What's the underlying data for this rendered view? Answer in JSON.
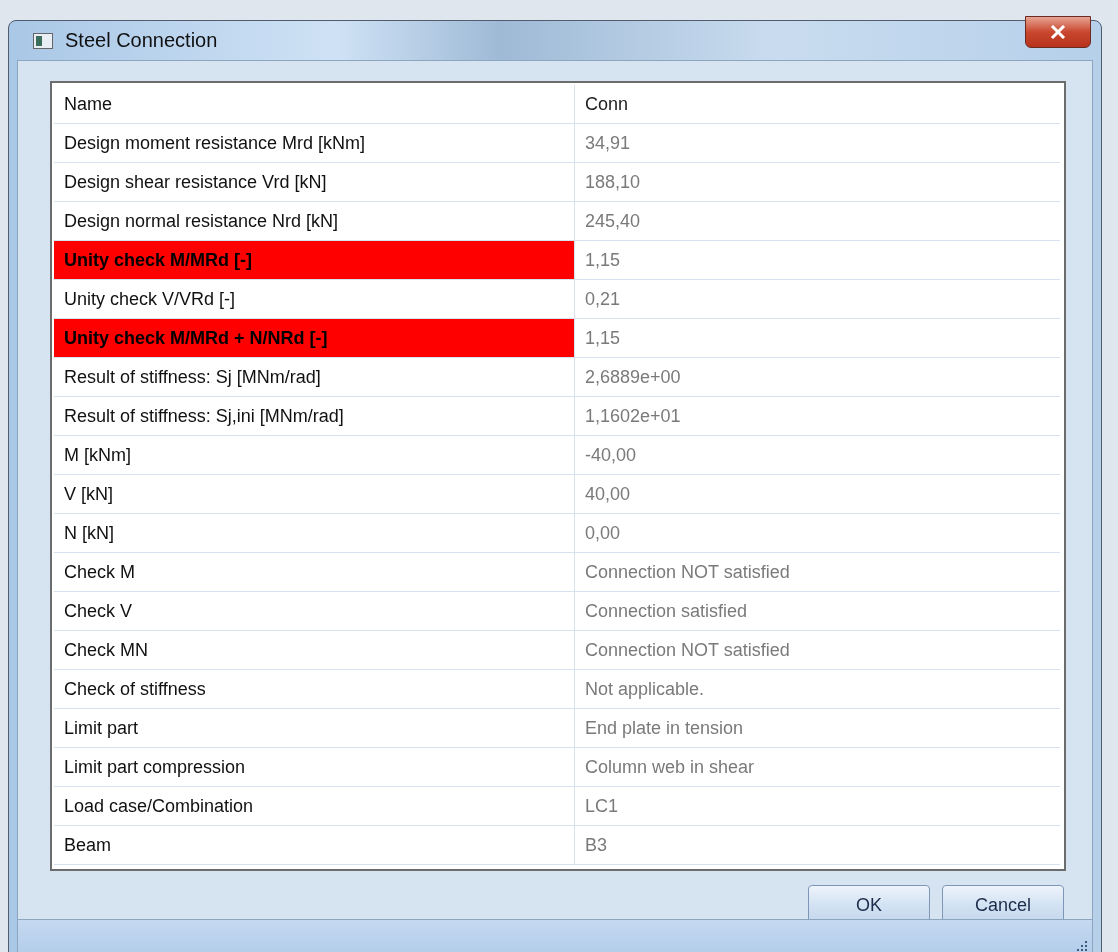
{
  "window": {
    "title": "Steel Connection"
  },
  "table": {
    "rows": [
      {
        "kind": "header",
        "name": "Name",
        "value": "Conn",
        "failed": false
      },
      {
        "kind": "value",
        "name": "Design moment resistance Mrd [kNm]",
        "value": "34,91",
        "failed": false
      },
      {
        "kind": "value",
        "name": "Design shear resistance Vrd [kN]",
        "value": "188,10",
        "failed": false
      },
      {
        "kind": "value",
        "name": "Design normal resistance Nrd [kN]",
        "value": "245,40",
        "failed": false
      },
      {
        "kind": "value",
        "name": "Unity check M/MRd  [-]",
        "value": "1,15",
        "failed": true
      },
      {
        "kind": "value",
        "name": "Unity check V/VRd  [-]",
        "value": "0,21",
        "failed": false
      },
      {
        "kind": "value",
        "name": "Unity check M/MRd + N/NRd [-]",
        "value": "1,15",
        "failed": true
      },
      {
        "kind": "value",
        "name": "Result of stiffness: Sj [MNm/rad]",
        "value": "2,6889e+00",
        "failed": false
      },
      {
        "kind": "value",
        "name": "Result of stiffness: Sj,ini [MNm/rad]",
        "value": "1,1602e+01",
        "failed": false
      },
      {
        "kind": "value",
        "name": "M [kNm]",
        "value": "-40,00",
        "failed": false
      },
      {
        "kind": "value",
        "name": "V [kN]",
        "value": "40,00",
        "failed": false
      },
      {
        "kind": "value",
        "name": "N [kN]",
        "value": "0,00",
        "failed": false
      },
      {
        "kind": "value",
        "name": "Check M",
        "value": "Connection  NOT satisfied",
        "failed": false
      },
      {
        "kind": "value",
        "name": "Check V",
        "value": "Connection satisfied",
        "failed": false
      },
      {
        "kind": "value",
        "name": "Check MN",
        "value": "Connection  NOT satisfied",
        "failed": false
      },
      {
        "kind": "value",
        "name": "Check of stiffness",
        "value": "Not applicable.",
        "failed": false
      },
      {
        "kind": "value",
        "name": "Limit part",
        "value": "End plate in tension",
        "failed": false
      },
      {
        "kind": "value",
        "name": "Limit part compression",
        "value": "Column web in shear",
        "failed": false
      },
      {
        "kind": "value",
        "name": "Load case/Combination",
        "value": "LC1",
        "failed": false
      },
      {
        "kind": "value",
        "name": "Beam",
        "value": "B3",
        "failed": false
      }
    ]
  },
  "buttons": [
    "OK",
    "Cancel"
  ]
}
